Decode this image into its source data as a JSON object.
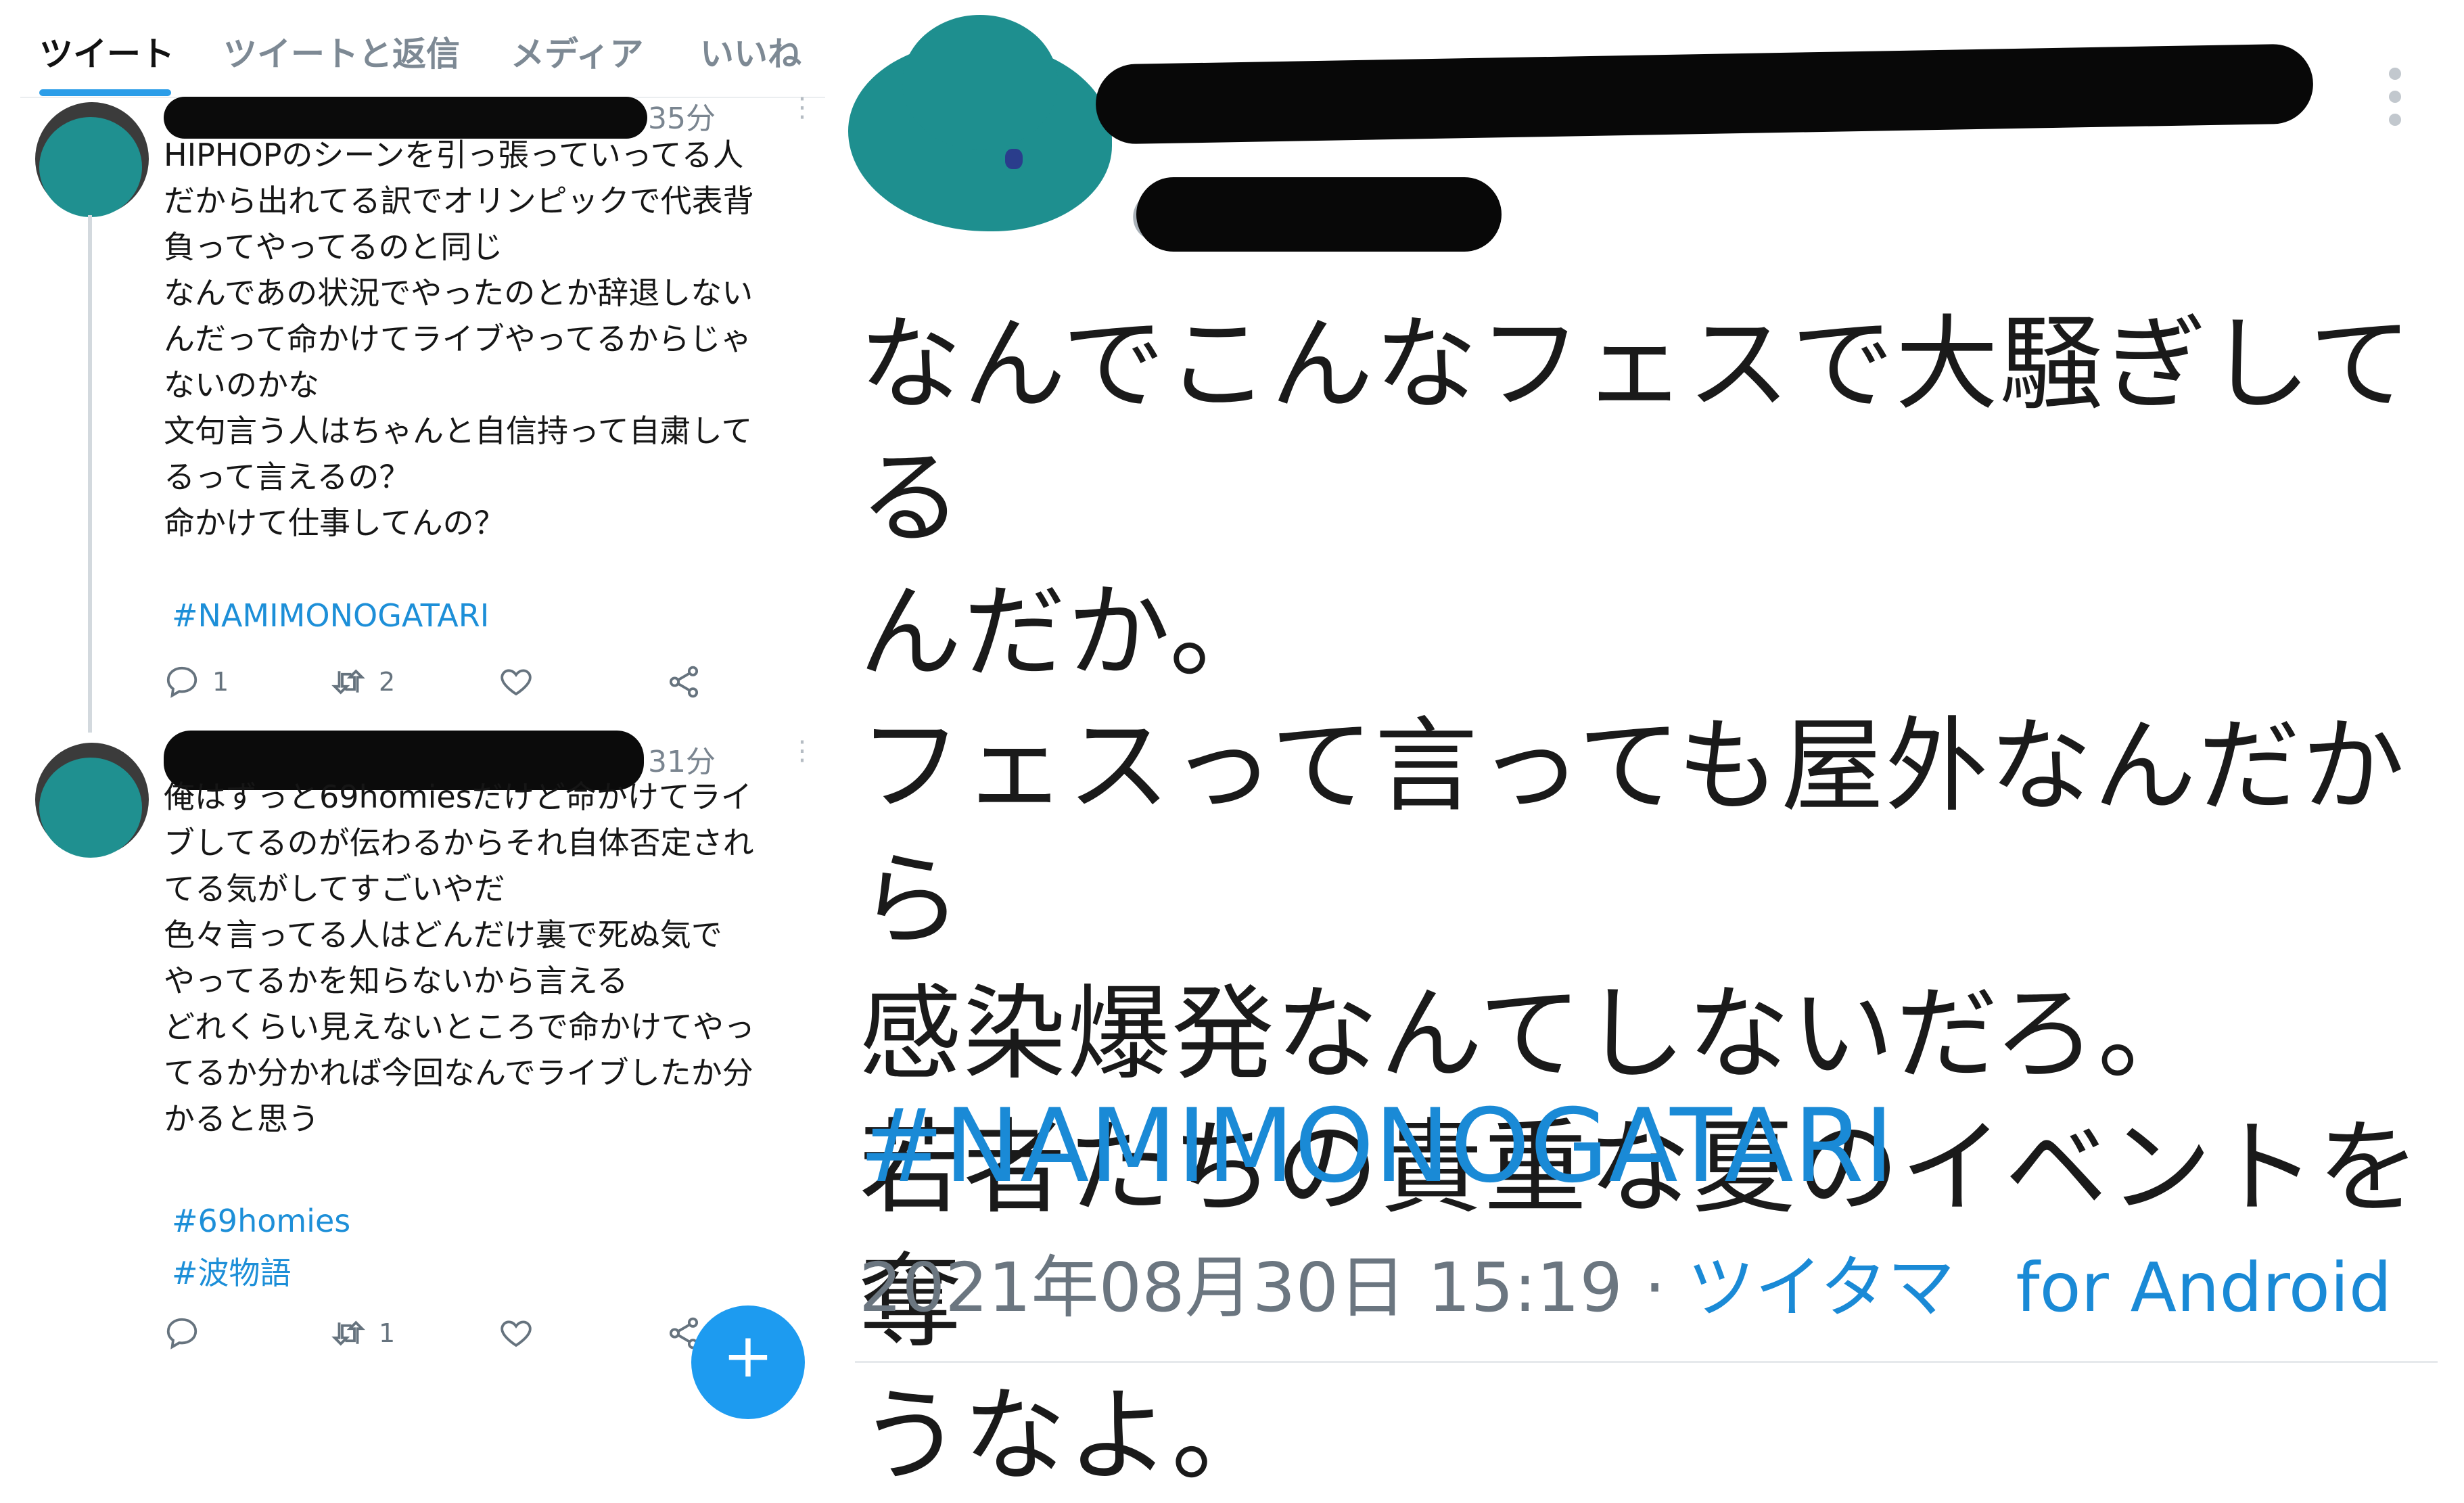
{
  "tabs": [
    "ツイート",
    "ツイートと返信",
    "メディア",
    "いいね"
  ],
  "tweets": [
    {
      "time": "35分",
      "body": "HIPHOPのシーンを引っ張っていってる人\nだから出れてる訳でオリンピックで代表背\n負ってやってるのと同じ\nなんであの状況でやったのとか辞退しない\nんだって命かけてライブやってるからじゃ\nないのかな\n文句言う人はちゃんと自信持って自粛して\nるって言えるの？\n命かけて仕事してんの？",
      "hashtags": [
        "#NAMIMONOGATARI"
      ],
      "replies": "1",
      "retweets": "2"
    },
    {
      "time": "31分",
      "body": "俺はずっと69homiesだけど命かけてライ\nブしてるのが伝わるからそれ自体否定され\nてる気がしてすごいやだ\n色々言ってる人はどんだけ裏で死ぬ気で\nやってるかを知らないから言える\nどれくらい見えないところで命かけてやっ\nてるか分かれば今回なんでライブしたか分\nかると思う",
      "hashtags": [
        "#69homies",
        "#波物語"
      ],
      "replies": "",
      "retweets": "1"
    }
  ],
  "fab_icon": "+",
  "detail": {
    "text": "なんでこんなフェスで大騒ぎしてる\nんだか。\nフェスって言っても屋外なんだから\n感染爆発なんてしないだろ。\n若者たちの貴重な夏のイベントを奪\nうなよ。",
    "hashtag": "#NAMIMONOGATARI",
    "timestamp": "2021年08月30日 15:19 · ",
    "source": "ツイタマ",
    "client": "for Android"
  },
  "colors": {
    "accent": "#1d9bf0",
    "hashtag": "#1a8ad6",
    "avatar": "#1f9090",
    "redaction": "#0b0b0b"
  },
  "icons": [
    "reply-icon",
    "retweet-icon",
    "like-icon",
    "share-icon",
    "more-icon",
    "compose-icon"
  ]
}
